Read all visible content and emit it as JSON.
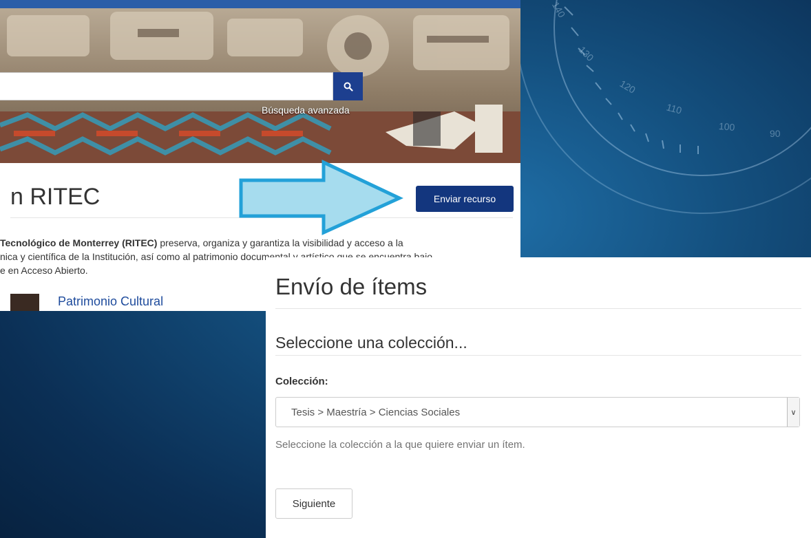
{
  "background": {
    "dial_numbers": [
      "140",
      "130",
      "120",
      "110",
      "100",
      "90"
    ]
  },
  "left_screenshot": {
    "search": {
      "placeholder": "",
      "advanced_label": "Búsqueda avanzada",
      "icon": "search-icon"
    },
    "title": "n RITEC",
    "submit_button": "Enviar recurso",
    "description": {
      "line1_bold": "Tecnológico de Monterrey (RITEC)",
      "line1_rest": " preserva, organiza y garantiza la visibilidad y acceso a la",
      "line2": "nica y científica de la Institución, así como al patrimonio documental y artístico que se encuentra bajo",
      "line3": "e en Acceso Abierto."
    },
    "community_link": "Patrimonio Cultural"
  },
  "right_screenshot": {
    "title": "Envío de ítems",
    "section_heading": "Seleccione una colección...",
    "collection_label": "Colección:",
    "collection_selected": "Tesis > Maestría > Ciencias Sociales",
    "help_text": "Seleccione la colección a la que quiere enviar un ítem.",
    "next_button": "Siguiente"
  },
  "colors": {
    "brand_blue": "#13367e",
    "arrow_fill": "#a6dcee",
    "arrow_stroke": "#23a1d8",
    "link": "#1e4b9c"
  }
}
